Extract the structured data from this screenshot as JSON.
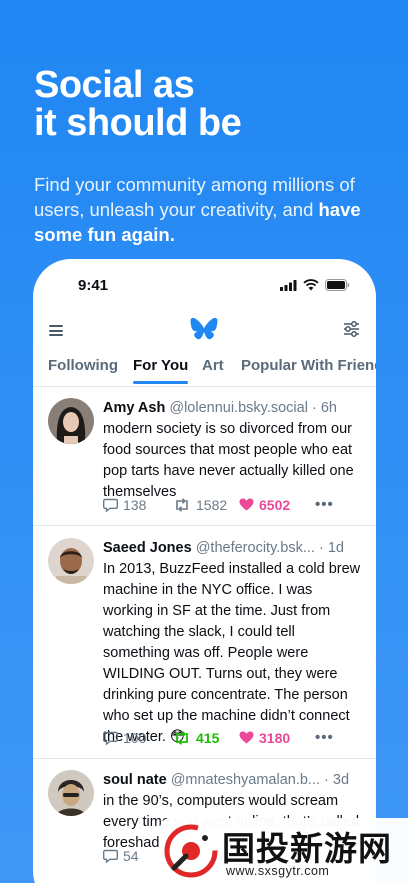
{
  "hero": {
    "title": "Social as\nit should be",
    "subtitle_plain": "Find your community among millions of users, unleash your creativity, and ",
    "subtitle_bold": "have some fun again."
  },
  "status_bar": {
    "time": "9:41"
  },
  "tabs": [
    "Following",
    "For You",
    "Art",
    "Popular With Friends"
  ],
  "active_tab": "For You",
  "icons": {
    "menu": "hamburger-menu-icon",
    "logo": "butterfly-logo-icon",
    "filter": "sliders-icon",
    "reply": "speech-bubble-icon",
    "repost": "repost-arrows-icon",
    "like": "heart-icon",
    "more": "ellipsis-icon"
  },
  "colors": {
    "brand": "#1f86f2",
    "like": "#ec4899",
    "repost": "#20bc07"
  },
  "posts": [
    {
      "name": "Amy Ash",
      "handle": "@lolennui.bsky.social",
      "sep": "·",
      "ago": "6h",
      "text": "modern society is so divorced from our food sources that most people who eat pop tarts have never actually killed one themselves",
      "replies": "138",
      "reposts": "1582",
      "likes": "6502",
      "more": "•••"
    },
    {
      "name": "Saeed Jones",
      "handle": "@theferocity.bsk...",
      "sep": "·",
      "ago": "1d",
      "text": "In 2013, BuzzFeed installed a cold brew machine in the NYC office. I was working in SF at the time. Just from watching the slack, I could tell something was off. People were WILDING OUT. Turns out, they were drinking pure concentrate. The person who set up the machine didn’t connect the water. 😳",
      "replies": "100",
      "reposts": "415",
      "likes": "3180",
      "more": "•••"
    },
    {
      "name": "soul nate",
      "handle": "@mnateshyamalan.b...",
      "sep": "·",
      "ago": "3d",
      "text": "in the 90’s, computers would scream every time you went online. that’s called foreshad",
      "replies": "54"
    }
  ],
  "watermark": {
    "title": "国投新游网",
    "url": "www.sxsgytr.com"
  }
}
